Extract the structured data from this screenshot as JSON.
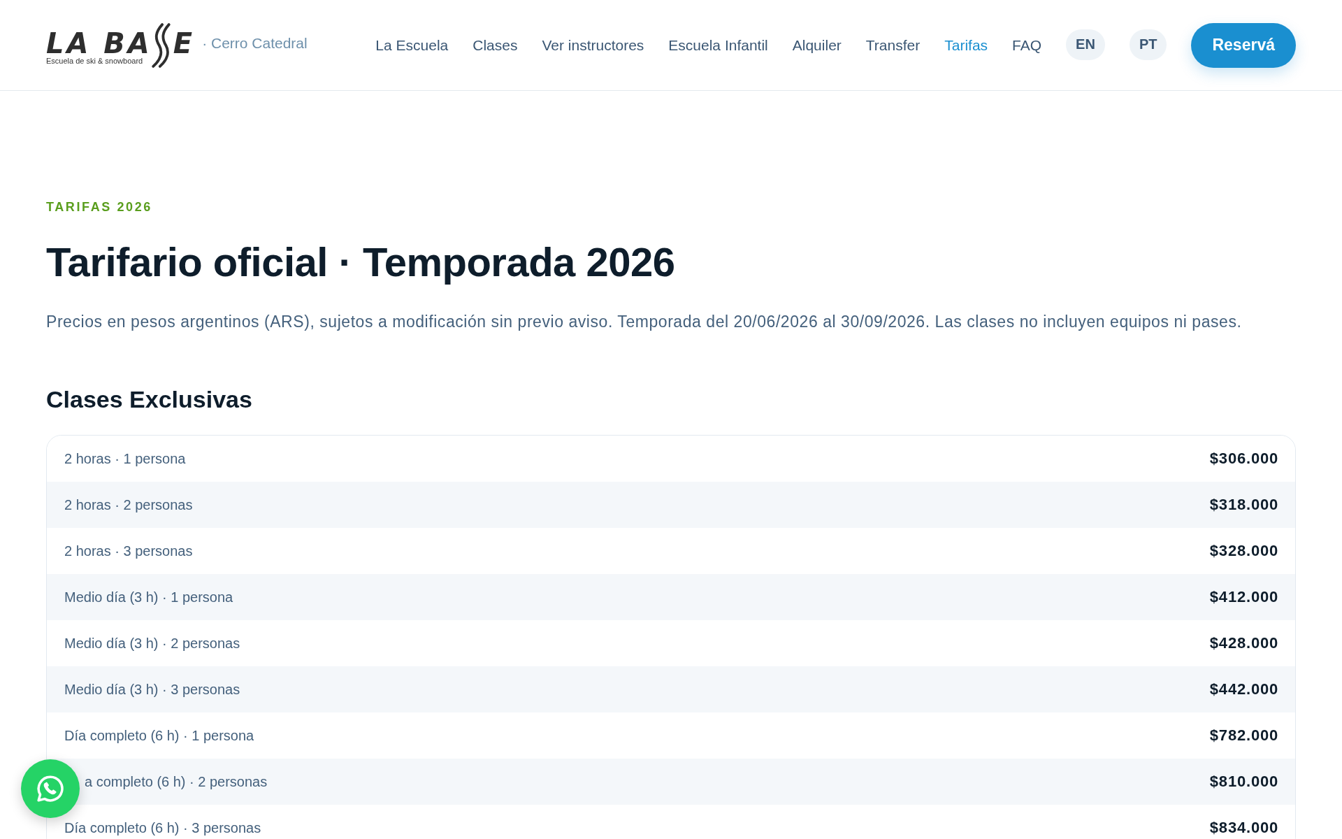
{
  "header": {
    "logo": {
      "wordmark_start": "LA BA",
      "wordmark_end": "E",
      "tagline": "Escuela de ski & snowboard"
    },
    "location": "· Cerro Catedral",
    "nav": [
      {
        "label": "La Escuela",
        "selected": false
      },
      {
        "label": "Clases",
        "selected": false
      },
      {
        "label": "Ver instructores",
        "selected": false
      },
      {
        "label": "Escuela Infantil",
        "selected": false
      },
      {
        "label": "Alquiler",
        "selected": false
      },
      {
        "label": "Transfer",
        "selected": false
      },
      {
        "label": "Tarifas",
        "selected": true
      },
      {
        "label": "FAQ",
        "selected": false
      }
    ],
    "languages": [
      "EN",
      "PT"
    ],
    "cta": "Reservá"
  },
  "intro": {
    "eyebrow": "TARIFAS 2026",
    "title": "Tarifario oficial · Temporada 2026",
    "description": "Precios en pesos argentinos (ARS), sujetos a modificación sin previo aviso. Temporada del 20/06/2026 al 30/09/2026. Las clases no incluyen equipos ni pases."
  },
  "sections": [
    {
      "title": "Clases Exclusivas",
      "rows": [
        {
          "label": "2 horas · 1 persona",
          "price": "$306.000",
          "covered": false
        },
        {
          "label": "2 horas · 2 personas",
          "price": "$318.000",
          "covered": false
        },
        {
          "label": "2 horas · 3 personas",
          "price": "$328.000",
          "covered": false
        },
        {
          "label": "Medio día (3 h) · 1 persona",
          "price": "$412.000",
          "covered": false
        },
        {
          "label": "Medio día (3 h) · 2 personas",
          "price": "$428.000",
          "covered": false
        },
        {
          "label": "Medio día (3 h) · 3 personas",
          "price": "$442.000",
          "covered": false
        },
        {
          "label": "Día completo (6 h) · 1 persona",
          "price": "$782.000",
          "covered": false
        },
        {
          "label": "a completo (6 h) · 2 personas",
          "price": "$810.000",
          "covered": true
        },
        {
          "label": "Día completo (6 h) · 3 personas",
          "price": "$834.000",
          "covered": false
        }
      ]
    }
  ]
}
